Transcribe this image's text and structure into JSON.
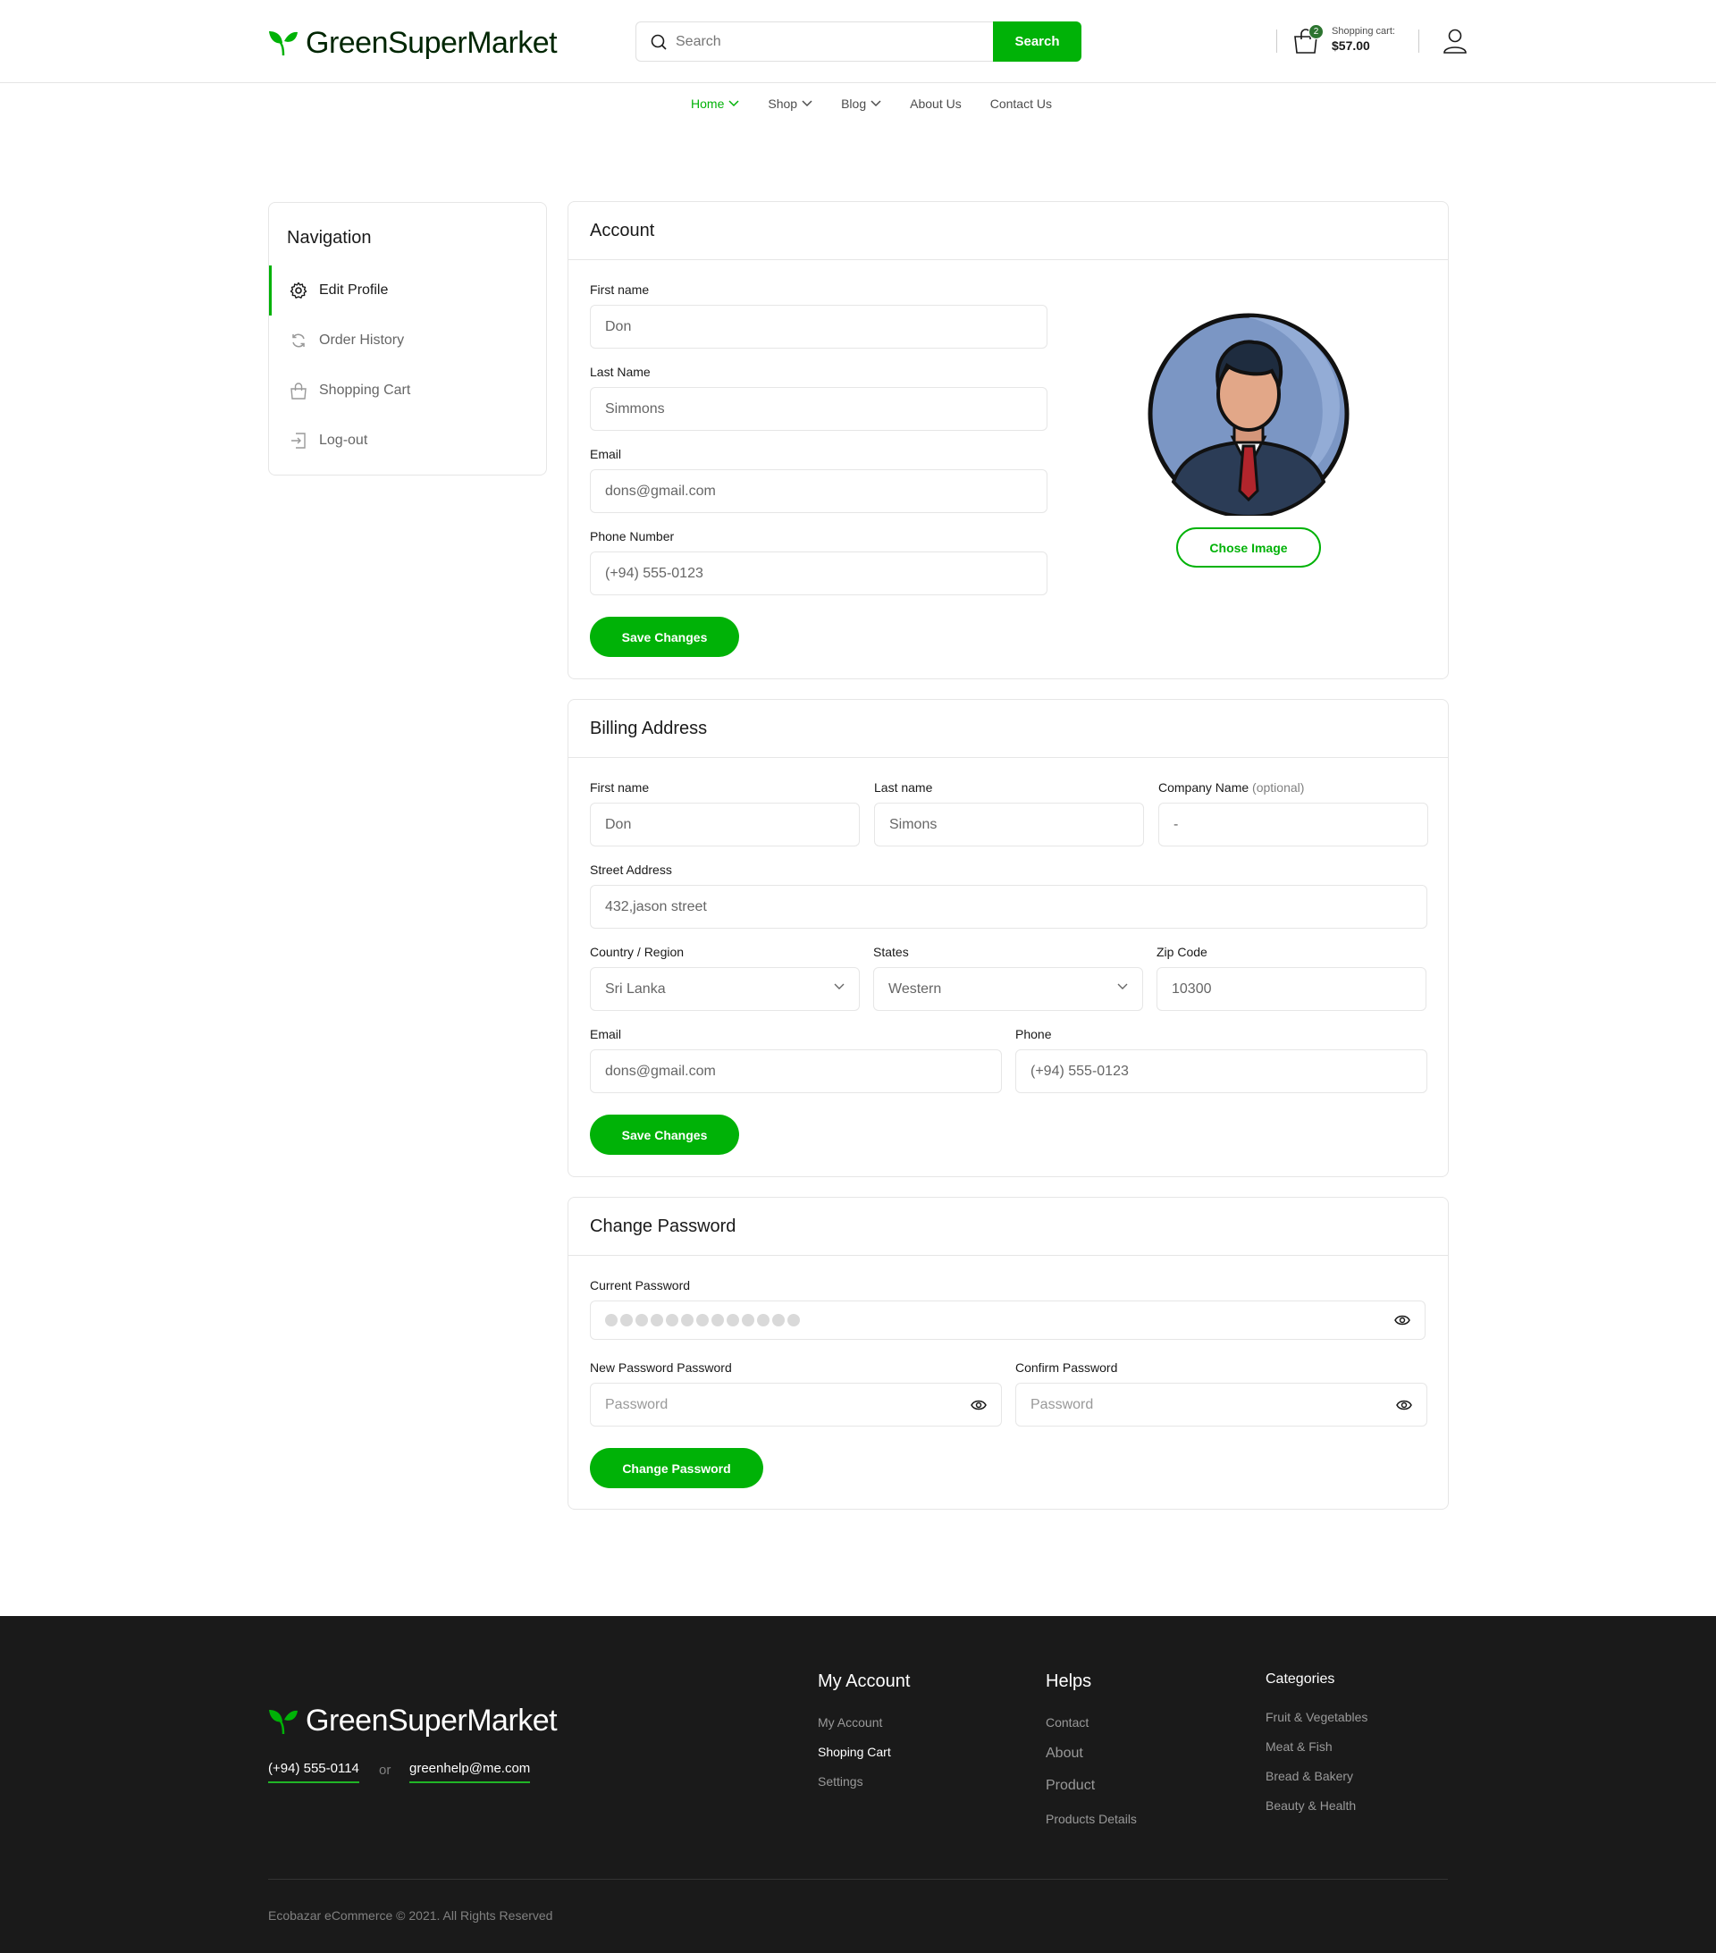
{
  "brand": {
    "name": "GreenSuperMarket",
    "accent": "#00b207",
    "dark": "#1a1a1a"
  },
  "header": {
    "search_placeholder": "Search",
    "search_button": "Search",
    "cart_label": "Shopping cart:",
    "cart_total": "$57.00",
    "cart_count": "2"
  },
  "nav": [
    {
      "label": "Home",
      "active": true,
      "dropdown": true
    },
    {
      "label": "Shop",
      "dropdown": true
    },
    {
      "label": "Blog",
      "dropdown": true
    },
    {
      "label": "About Us"
    },
    {
      "label": "Contact Us"
    }
  ],
  "sidebar": {
    "title": "Navigation",
    "items": [
      {
        "label": "Edit Profile",
        "icon": "gear-icon",
        "active": true
      },
      {
        "label": "Order History",
        "icon": "refresh-icon"
      },
      {
        "label": "Shopping Cart",
        "icon": "bag-icon"
      },
      {
        "label": "Log-out",
        "icon": "logout-icon"
      }
    ]
  },
  "account": {
    "title": "Account",
    "first_name_label": "First name",
    "first_name": "Don",
    "last_name_label": "Last Name",
    "last_name": "Simmons",
    "email_label": "Email",
    "email": "dons@gmail.com",
    "phone_label": "Phone Number",
    "phone": "(+94) 555-0123",
    "save": "Save Changes",
    "choose_image": "Chose Image"
  },
  "billing": {
    "title": "Billing Address",
    "first_name_label": "First name",
    "first_name": "Don",
    "last_name_label": "Last name",
    "last_name": "Simons",
    "company_label": "Company Name",
    "company_optional": "(optional)",
    "company": "-",
    "street_label": "Street Address",
    "street": "432,jason street",
    "country_label": "Country / Region",
    "country": "Sri Lanka",
    "state_label": "States",
    "state": "Western",
    "zip_label": "Zip Code",
    "zip": "10300",
    "email_label": "Email",
    "email": "dons@gmail.com",
    "phone_label": "Phone",
    "phone": "(+94) 555-0123",
    "save": "Save Changes"
  },
  "password": {
    "title": "Change Password",
    "current_label": "Current Password",
    "new_label": "New Password Password",
    "new_placeholder": "Password",
    "confirm_label": "Confirm Password",
    "confirm_placeholder": "Password",
    "submit": "Change Password"
  },
  "footer": {
    "phone": "(+94) 555-0114",
    "or": "or",
    "email": "greenhelp@me.com",
    "my_account": {
      "title": "My Account",
      "links": [
        "My Account",
        "Shoping Cart",
        "Settings"
      ]
    },
    "helps": {
      "title": "Helps",
      "links": [
        "Contact",
        "About",
        "Product",
        "Products Details"
      ]
    },
    "categories": {
      "title": "Categories",
      "links": [
        "Fruit & Vegetables",
        "Meat & Fish",
        "Bread & Bakery",
        "Beauty & Health"
      ]
    },
    "copyright": "Ecobazar eCommerce © 2021. All Rights Reserved"
  }
}
